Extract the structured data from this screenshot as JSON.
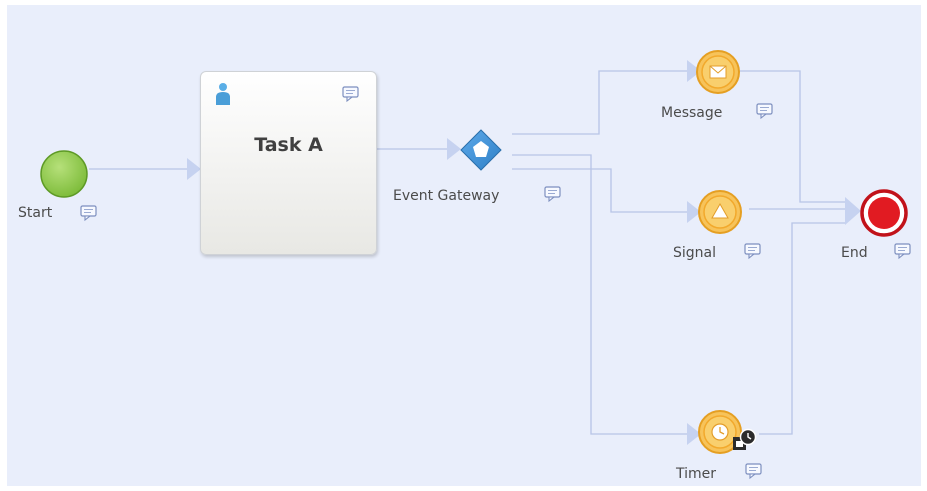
{
  "diagram": {
    "start": {
      "label": "Start"
    },
    "task": {
      "title": "Task A",
      "user_icon": "user-icon"
    },
    "gateway": {
      "label": "Event Gateway"
    },
    "message": {
      "label": "Message",
      "icon": "envelope-icon"
    },
    "signal": {
      "label": "Signal",
      "icon": "triangle-icon"
    },
    "timer": {
      "label": "Timer",
      "icon": "clock-icon"
    },
    "end": {
      "label": "End"
    }
  },
  "colors": {
    "canvas": "#e9eefb",
    "connector": "#b7c4e6",
    "start_fill": "#8cc84b",
    "end_fill": "#e11b22",
    "gateway": "#3c8fd5",
    "intermediate_event": "#f2b43a"
  }
}
